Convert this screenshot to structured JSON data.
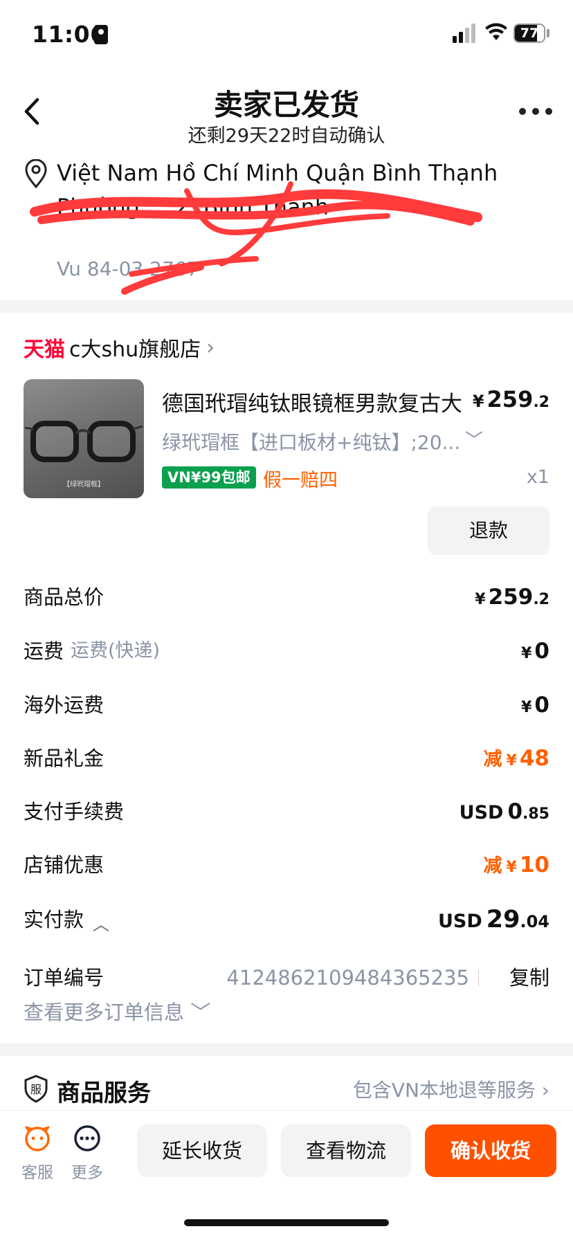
{
  "status_bar": {
    "time": "11:06",
    "battery": "77",
    "battery_level": 0.77
  },
  "header": {
    "title": "卖家已发货",
    "subtitle": "还剩29天22时自动确认"
  },
  "address": {
    "text": "Việt Nam Hồ Chí Minh Quận Bình Thạnh Phường ... 2, Binh Thanh",
    "contact": "Vu 84-03 2767"
  },
  "shop": {
    "logo": "天猫",
    "name": "c大shu旗舰店",
    "chevron": "›"
  },
  "product": {
    "title": "德国玳瑁纯钛眼镜框男款复古大",
    "price_yen": "¥",
    "price_int": "259",
    "price_dec": ".2",
    "sku": "绿玳瑁框【进口板材+纯钛】;20...",
    "shipping_badge": "VN¥99包邮",
    "guarantee": "假一赔四",
    "quantity": "x1",
    "image_caption": "【绿玳瑁框】",
    "refund_label": "退款"
  },
  "summary": {
    "goods_total": {
      "label": "商品总价",
      "yen": "¥",
      "int": "259",
      "dec": ".2"
    },
    "shipping": {
      "label": "运费",
      "sublabel": "运费(快递)",
      "yen": "¥",
      "value": "0"
    },
    "overseas_shipping": {
      "label": "海外运费",
      "yen": "¥",
      "value": "0"
    },
    "new_gift": {
      "label": "新品礼金",
      "prefix": "减",
      "yen": "¥",
      "value": "48"
    },
    "payment_fee": {
      "label": "支付手续费",
      "cur": "USD",
      "int": "0",
      "dec": ".85"
    },
    "shop_discount": {
      "label": "店铺优惠",
      "prefix": "减",
      "yen": "¥",
      "value": "10"
    },
    "paid": {
      "label": "实付款",
      "caret": "︿",
      "cur": "USD",
      "int": "29",
      "dec": ".04"
    }
  },
  "order": {
    "label": "订单编号",
    "number": "4124862109484365235",
    "copy": "复制",
    "more_info": "查看更多订单信息 ﹀"
  },
  "service": {
    "icon_text": "服",
    "title": "商品服务",
    "link": "包含VN本地退等服务 ›"
  },
  "bottom_bar": {
    "customer_service": "客服",
    "more": "更多",
    "extend": "延长收货",
    "logistics": "查看物流",
    "confirm": "确认收货"
  },
  "colors": {
    "accent": "#ff5000",
    "tmall": "#ff0036",
    "muted": "#8a94a6",
    "badge_green": "#0aa04e"
  }
}
